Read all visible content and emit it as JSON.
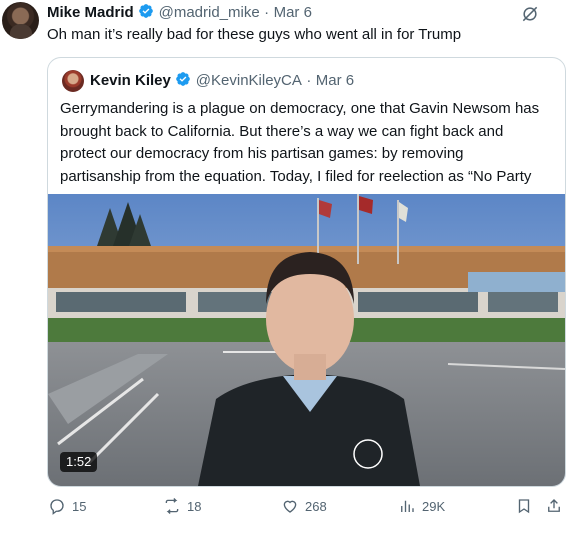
{
  "tweet": {
    "author_name": "Mike Madrid",
    "author_handle": "@madrid_mike",
    "separator": "·",
    "date": "Mar 6",
    "text": "Oh man it’s really bad for these guys who went all in for Trump"
  },
  "quote": {
    "author_name": "Kevin Kiley",
    "author_handle": "@KevinKileyCA",
    "separator": "·",
    "date": "Mar 6",
    "text_lines": [
      "Gerrymandering is a plague on democracy, one that Gavin Newsom has",
      "brought back to California. But there’s a way we can fight back and",
      "protect our democracy from his partisan games: by removing",
      "partisanship from the equation. Today, I filed for reelection as “No Party"
    ],
    "video_duration": "1:52"
  },
  "actions": {
    "replies": "15",
    "reposts": "18",
    "likes": "268",
    "views": "29K"
  },
  "colors": {
    "verified": "#1d9bf0",
    "text_primary": "#0f1419",
    "text_secondary": "#536471",
    "border": "#cfd9de"
  },
  "icons": [
    "verified-badge-icon",
    "grok-icon",
    "reply-icon",
    "repost-icon",
    "like-icon",
    "views-icon",
    "bookmark-icon",
    "share-icon"
  ]
}
